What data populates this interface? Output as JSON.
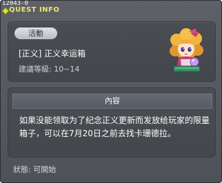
{
  "header": {
    "quest_id": "12043-0",
    "title": "QUEST INFO"
  },
  "summary": {
    "category_tag": "活動",
    "quest_name": "[正义] 正义幸运箱",
    "level_text": "建議等級: 10~14"
  },
  "content": {
    "section_title": "內容",
    "description": "如果没能领取为了纪念正义更新而发放给玩家的限量箱子，可以在7月20日之前去找卡珊德拉。"
  },
  "footer": {
    "status_text": "狀態:  可開始"
  },
  "colors": {
    "title_color": "#f2e66a",
    "window_bg": "#55585e"
  }
}
